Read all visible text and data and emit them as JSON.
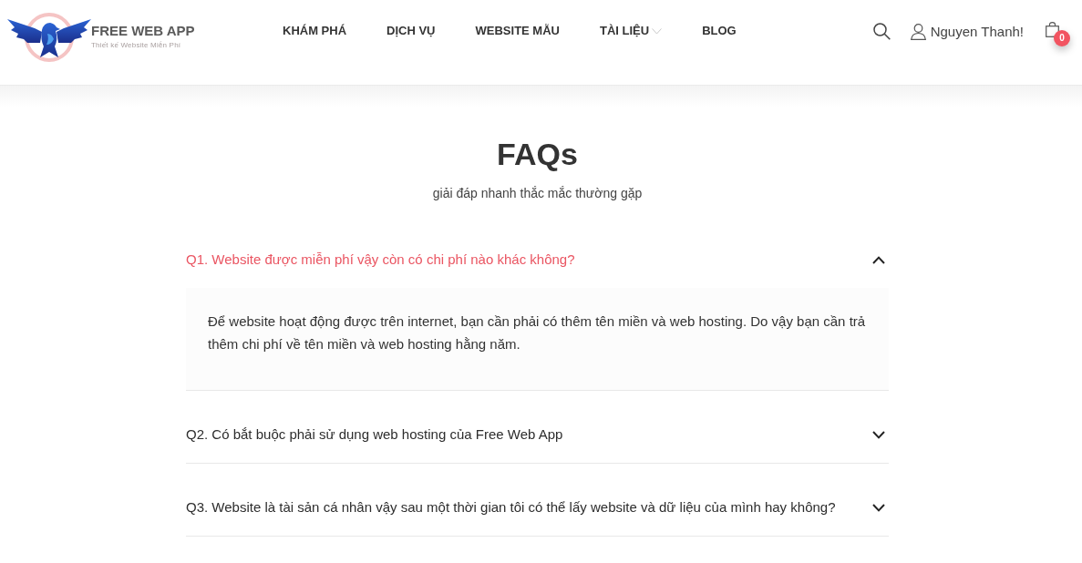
{
  "header": {
    "brand": {
      "name": "FREE WEB APP",
      "tagline": "Thiết kế Website Miễn Phí"
    },
    "nav": [
      {
        "label": "KHÁM PHÁ",
        "kind": "link"
      },
      {
        "label": "DỊCH VỤ",
        "kind": "link"
      },
      {
        "label": "WEBSITE MẪU",
        "kind": "link"
      },
      {
        "label": "TÀI LIỆU",
        "kind": "dropdown"
      },
      {
        "label": "BLOG",
        "kind": "link"
      }
    ],
    "user": {
      "name": "Nguyen Thanh!"
    },
    "cart": {
      "count": "0"
    }
  },
  "faq": {
    "title": "FAQs",
    "subtitle": "giải đáp nhanh thắc mắc thường gặp",
    "items": [
      {
        "question": "Q1. Website được miễn phí vậy còn có chi phí nào khác không?",
        "expanded": true,
        "answer": "Để website hoạt động được trên internet, bạn cần phải có thêm tên miền và web hosting. Do vậy bạn cần trả thêm chi phí về tên miền và web hosting hằng năm."
      },
      {
        "question": "Q2. Có bắt buộc phải sử dụng web hosting của Free Web App",
        "expanded": false
      },
      {
        "question": "Q3. Website là tài sản cá nhân vậy sau một thời gian tôi có thể lấy website và dữ liệu của mình hay không?",
        "expanded": false
      }
    ]
  }
}
